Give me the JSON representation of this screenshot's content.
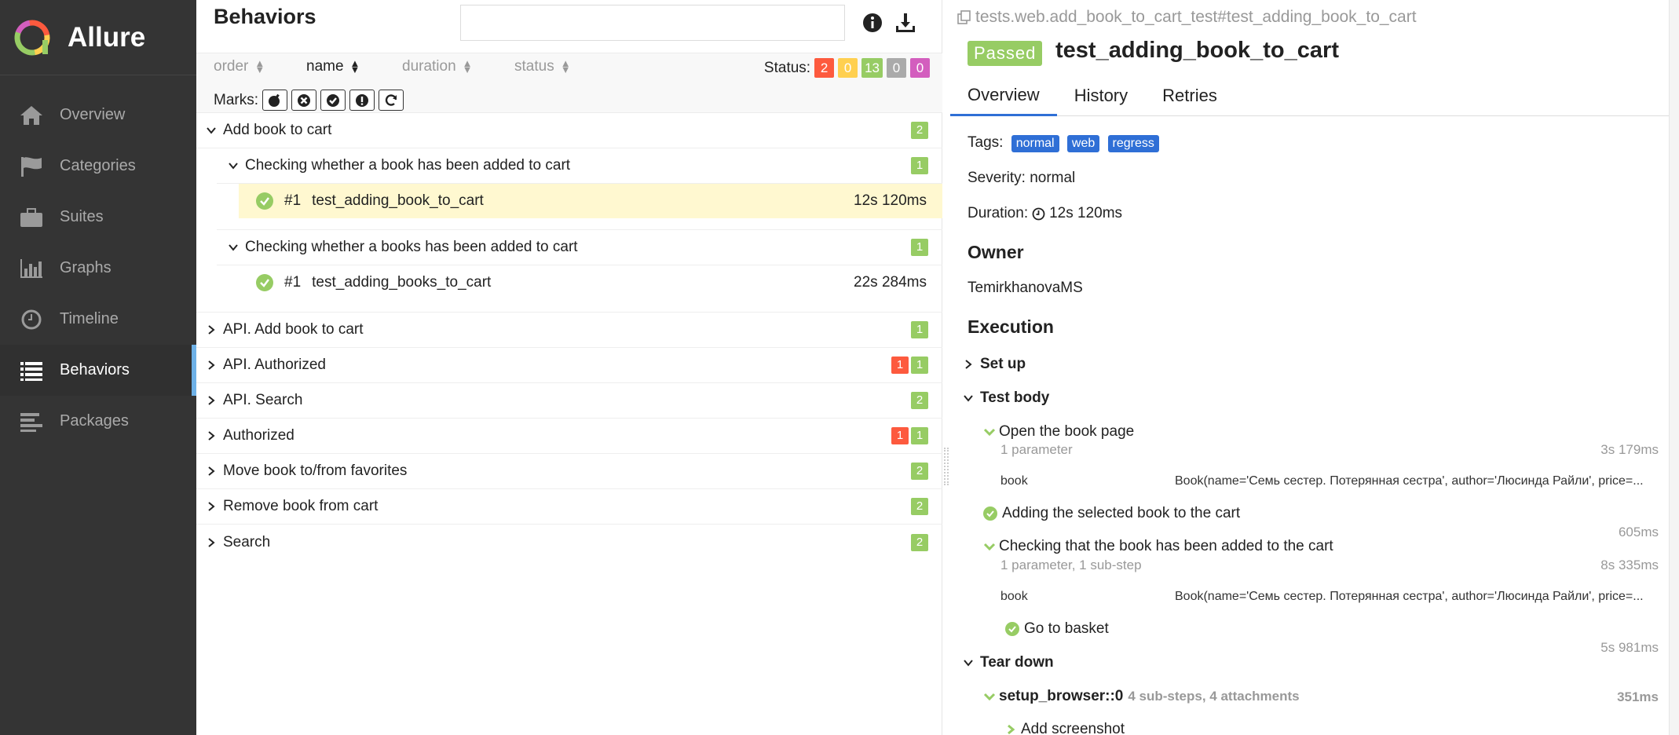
{
  "brand": {
    "name": "Allure"
  },
  "sidebar": {
    "items": [
      {
        "label": "Overview",
        "icon": "home-icon"
      },
      {
        "label": "Categories",
        "icon": "flag-icon"
      },
      {
        "label": "Suites",
        "icon": "briefcase-icon"
      },
      {
        "label": "Graphs",
        "icon": "bar-chart-icon"
      },
      {
        "label": "Timeline",
        "icon": "clock-icon"
      },
      {
        "label": "Behaviors",
        "icon": "list-icon"
      },
      {
        "label": "Packages",
        "icon": "align-left-icon"
      }
    ]
  },
  "middle": {
    "title": "Behaviors",
    "search": {
      "value": "",
      "placeholder": ""
    },
    "sort": {
      "order": "order",
      "name": "name",
      "duration": "duration",
      "status": "status"
    },
    "status_label": "Status:",
    "status_counts": {
      "failed": "2",
      "broken": "0",
      "passed": "13",
      "skipped": "0",
      "unknown": "0"
    },
    "marks_label": "Marks:",
    "groups": [
      {
        "label": "Add book to cart",
        "badges": [
          "2"
        ]
      },
      {
        "label": "API. Add book to cart",
        "badges": [
          "1"
        ]
      },
      {
        "label": "API. Authorized",
        "badges": [
          "1",
          "1"
        ]
      },
      {
        "label": "API. Search",
        "badges": [
          "2"
        ]
      },
      {
        "label": "Authorized",
        "badges": [
          "1",
          "1"
        ]
      },
      {
        "label": "Move book to/from favorites",
        "badges": [
          "2"
        ]
      },
      {
        "label": "Remove book from cart",
        "badges": [
          "2"
        ]
      },
      {
        "label": "Search",
        "badges": [
          "2"
        ]
      }
    ],
    "subgroups": [
      {
        "label": "Checking whether a book has been added to cart",
        "badge": "1",
        "test": {
          "num": "#1",
          "name": "test_adding_book_to_cart",
          "duration": "12s 120ms"
        }
      },
      {
        "label": "Checking whether a books has been added to cart",
        "badge": "1",
        "test": {
          "num": "#1",
          "name": "test_adding_books_to_cart",
          "duration": "22s 284ms"
        }
      }
    ]
  },
  "detail": {
    "path": "tests.web.add_book_to_cart_test#test_adding_book_to_cart",
    "status": "Passed",
    "name": "test_adding_book_to_cart",
    "tabs": [
      "Overview",
      "History",
      "Retries"
    ],
    "tags_label": "Tags:",
    "tags": [
      "normal",
      "web",
      "regress"
    ],
    "severity": "Severity: normal",
    "duration_label": "Duration:",
    "duration": "12s 120ms",
    "owner_heading": "Owner",
    "owner": "TemirkhanovaMS",
    "execution_heading": "Execution",
    "setup": "Set up",
    "test_body": "Test body",
    "steps": [
      {
        "name": "Open the book page",
        "sub": "1 parameter",
        "duration": "3s 179ms",
        "param_name": "book",
        "param_value": "Book(name='Семь сестер. Потерянная сестра', author='Люсинда Райли', price=..."
      },
      {
        "name": "Adding the selected book to the cart",
        "duration": "605ms"
      },
      {
        "name": "Checking that the book has been added to the cart",
        "sub": "1 parameter, 1 sub-step",
        "duration": "8s 335ms",
        "param_name": "book",
        "param_value": "Book(name='Семь сестер. Потерянная сестра', author='Люсинда Райли', price=..."
      },
      {
        "name": "Go to basket",
        "duration": "5s 981ms"
      }
    ],
    "teardown": "Tear down",
    "teardown_step": {
      "name": "setup_browser::0",
      "sub": "4 sub-steps, 4 attachments",
      "duration": "351ms"
    },
    "teardown_child": "Add screenshot"
  },
  "colors": {
    "passed": "#97cc64",
    "failed": "#fd5a3e",
    "broken": "#ffd050",
    "skipped": "#aaaaaa",
    "unknown": "#d35ebe",
    "tag": "#2f6fd6",
    "sidebar": "#343434"
  }
}
